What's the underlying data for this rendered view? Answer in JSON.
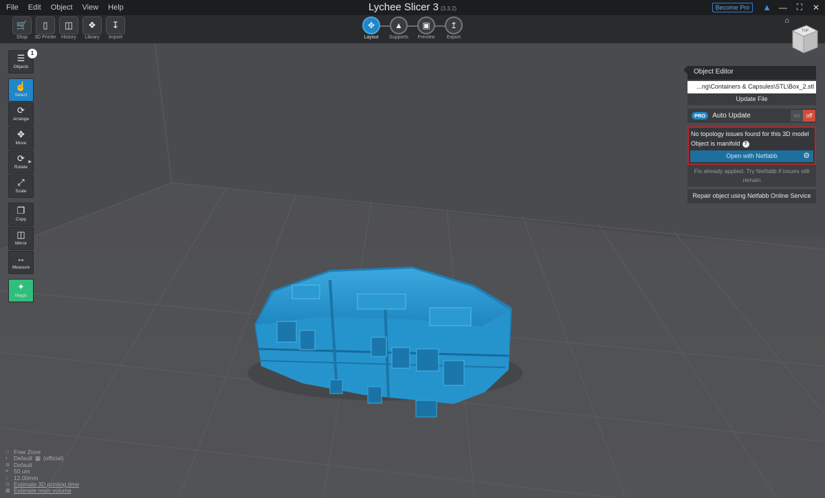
{
  "menu": [
    "File",
    "Edit",
    "Object",
    "View",
    "Help"
  ],
  "app": {
    "title": "Lychee Slicer 3",
    "version": "(3.3.2)"
  },
  "window": {
    "become_pro": "Become Pro"
  },
  "toolbar": {
    "tools": [
      "Shop",
      "3D Printer",
      "History",
      "Library",
      "Import"
    ],
    "steps": [
      "Layout",
      "Supports",
      "Preview",
      "Export"
    ]
  },
  "viewcube": {
    "top_label": "TOP"
  },
  "sidebar": {
    "objects_count": "1",
    "items": [
      "Objects",
      "Select",
      "Arrange",
      "Move",
      "Rotate",
      "Scale",
      "Copy",
      "Mirror",
      "Measure",
      "Magic"
    ]
  },
  "editor": {
    "title": "Object Editor",
    "file_path": "...ng\\Containers & Capsules\\STL\\Box_2.stl",
    "update_file": "Update File",
    "pro_badge": "PRO",
    "auto_update": "Auto Update",
    "toggle_on": "on",
    "toggle_off": "off",
    "topology_msg": "No topology issues found for this 3D model",
    "manifold_msg": "Object is manifold",
    "help": "?",
    "open_netfabb": "Open with Netfabb",
    "fix_note": "Fix already applied. Try Netfabb if issues still remain",
    "repair_online": "Repair object using Netfabb Online Service"
  },
  "status": {
    "zone": "Free Zone",
    "resin": "Default",
    "resin_tag": "(official)",
    "profile": "Default",
    "layer": "50 um",
    "height": "12.00mm",
    "est_time": "Estimate 3D printing time",
    "est_volume": "Estimate resin volume"
  },
  "colors": {
    "accent": "#1f86c8",
    "model": "#2f9fd6",
    "magic": "#2fbf7b",
    "warning_border": "#b3282e",
    "toggle_off": "#d24c3c"
  }
}
